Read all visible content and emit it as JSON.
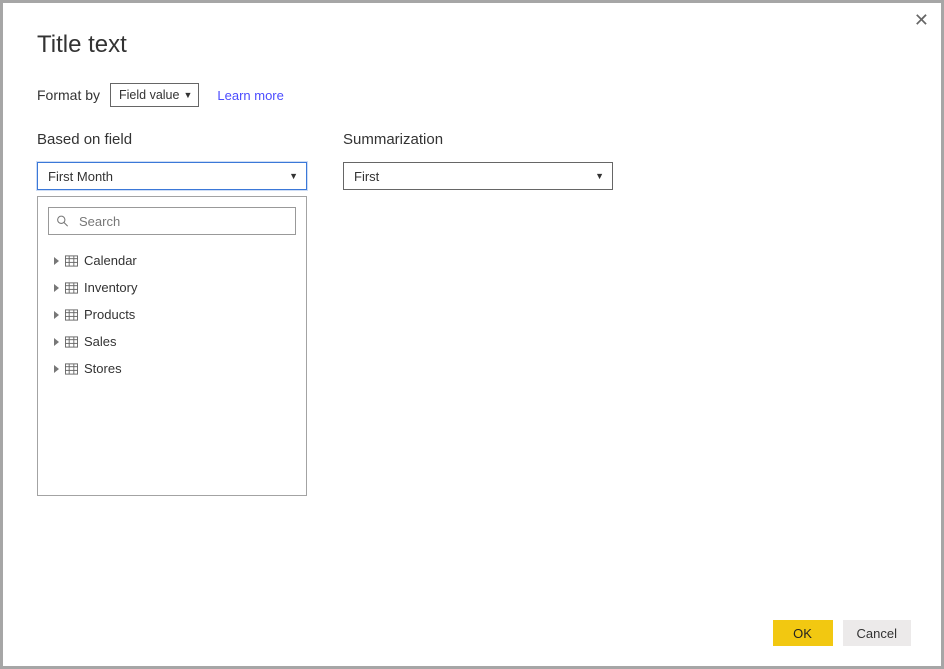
{
  "dialog": {
    "title": "Title text",
    "close_tooltip": "Close"
  },
  "format": {
    "label": "Format by",
    "selected": "Field value",
    "learn_more": "Learn more"
  },
  "based_on_field": {
    "label": "Based on field",
    "selected": "First Month",
    "search_placeholder": "Search",
    "tables": [
      {
        "name": "Calendar"
      },
      {
        "name": "Inventory"
      },
      {
        "name": "Products"
      },
      {
        "name": "Sales"
      },
      {
        "name": "Stores"
      }
    ]
  },
  "summarization": {
    "label": "Summarization",
    "selected": "First"
  },
  "footer": {
    "ok": "OK",
    "cancel": "Cancel"
  }
}
